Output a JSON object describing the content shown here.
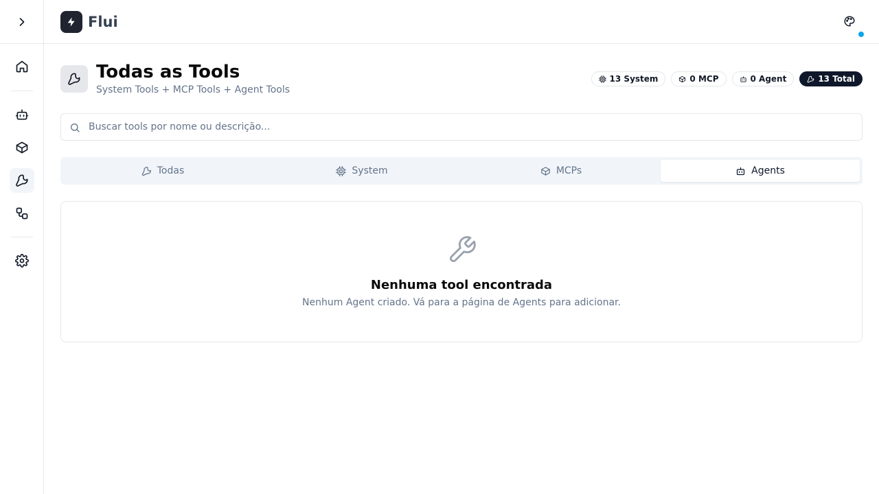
{
  "app": {
    "name": "Flui"
  },
  "header": {
    "title": "Todas as Tools",
    "subtitle": "System Tools + MCP Tools + Agent Tools"
  },
  "badges": [
    {
      "label": "13 System",
      "icon": "cpu-icon"
    },
    {
      "label": "0 MCP",
      "icon": "package-icon"
    },
    {
      "label": "0 Agent",
      "icon": "bot-icon"
    },
    {
      "label": "13 Total",
      "icon": "wrench-icon"
    }
  ],
  "search": {
    "placeholder": "Buscar tools por nome ou descrição...",
    "value": ""
  },
  "tabs": [
    {
      "label": "Todas",
      "icon": "wrench-icon",
      "active": false
    },
    {
      "label": "System",
      "icon": "cpu-icon",
      "active": false
    },
    {
      "label": "MCPs",
      "icon": "package-icon",
      "active": false
    },
    {
      "label": "Agents",
      "icon": "bot-icon",
      "active": true
    }
  ],
  "empty_state": {
    "title": "Nenhuma tool encontrada",
    "description": "Nenhum Agent criado. Vá para a página de Agents para adicionar."
  },
  "sidebar": {
    "items": [
      {
        "name": "home",
        "icon": "home-icon"
      },
      {
        "name": "agents",
        "icon": "bot-icon"
      },
      {
        "name": "mcps",
        "icon": "package-icon"
      },
      {
        "name": "tools",
        "icon": "wrench-icon",
        "active": true
      },
      {
        "name": "workflows",
        "icon": "workflow-icon"
      },
      {
        "name": "settings",
        "icon": "gear-icon"
      }
    ]
  },
  "colors": {
    "accent": "#0f172a",
    "notification_dot": "#0ea5e9",
    "logo_bg": "#1f2430"
  }
}
